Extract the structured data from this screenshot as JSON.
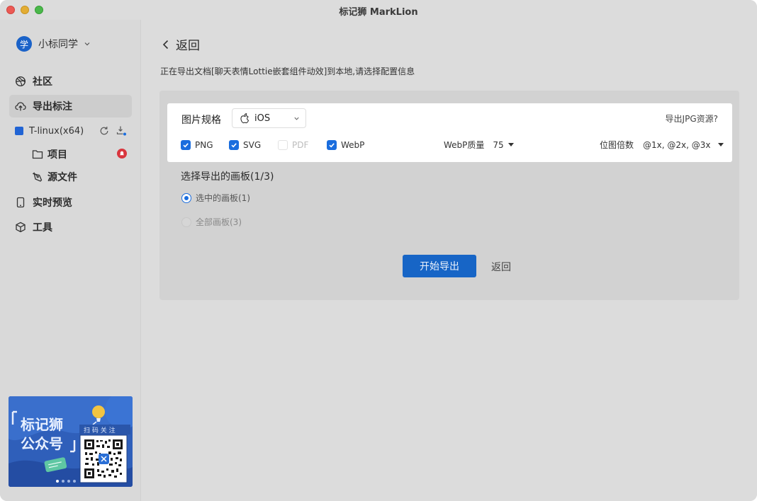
{
  "window": {
    "title": "标记狮 MarkLion"
  },
  "sidebar": {
    "user": {
      "avatar_text": "学",
      "name": "小标同学"
    },
    "nav": [
      {
        "label": "社区",
        "icon": "basketball-icon"
      },
      {
        "label": "导出标注",
        "icon": "cloud-upload-icon",
        "active": true
      }
    ],
    "project": {
      "name": "T-linux(x64)",
      "color": "#2164d4"
    },
    "project_items": [
      {
        "label": "项目",
        "icon": "folder-icon"
      },
      {
        "label": "源文件",
        "icon": "pen-tool-icon"
      }
    ],
    "nav_bottom": [
      {
        "label": "实时预览",
        "icon": "phone-icon"
      },
      {
        "label": "工具",
        "icon": "cube-icon"
      }
    ],
    "banner": {
      "title_line1": "标记狮",
      "title_line2": "公众号",
      "scan_text": "扫 码 关 注"
    }
  },
  "main": {
    "back_label": "返回",
    "subtitle": "正在导出文档[聊天表情Lottie嵌套组件动效]到本地,请选择配置信息",
    "spec_label": "图片规格",
    "platform": "iOS",
    "jpg_link": "导出JPG资源?",
    "formats": [
      {
        "label": "PNG",
        "checked": true
      },
      {
        "label": "SVG",
        "checked": true
      },
      {
        "label": "PDF",
        "checked": false
      },
      {
        "label": "WebP",
        "checked": true
      }
    ],
    "webp_quality_label": "WebP质量",
    "webp_quality_value": "75",
    "scale_label": "位图倍数",
    "scale_value": "@1x, @2x, @3x",
    "artboard_title": "选择导出的画板(1/3)",
    "radio_selected": "选中的画板(1)",
    "radio_all": "全部画板(3)",
    "start_button": "开始导出",
    "cancel_button": "返回"
  },
  "colors": {
    "accent": "#1a6dde",
    "button": "#1765c6",
    "alert": "#d9363e"
  }
}
